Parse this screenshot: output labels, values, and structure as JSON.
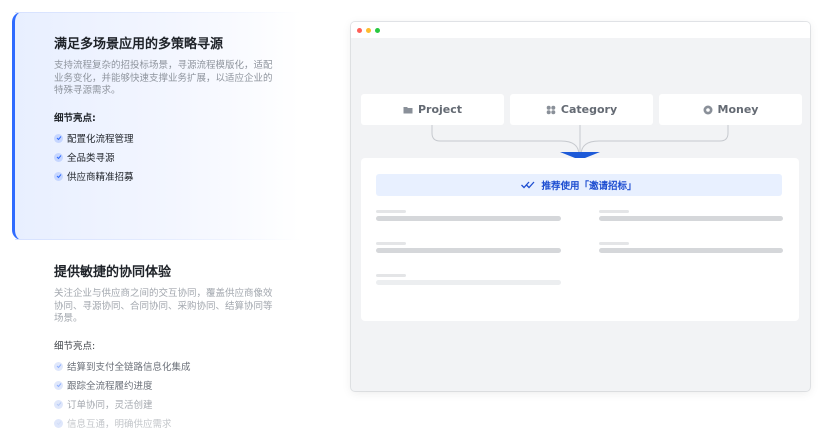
{
  "features": [
    {
      "title": "满足多场景应用的多策略寻源",
      "desc": "支持流程复杂的招投标场景，寻源流程模版化，适配业务变化，并能够快速支撑业务扩展，以适应企业的特殊寻源需求。",
      "sub_label": "细节亮点:",
      "items": [
        "配置化流程管理",
        "全品类寻源",
        "供应商精准招募"
      ]
    },
    {
      "title": "提供敏捷的协同体验",
      "desc": "关注企业与供应商之间的交互协同，覆盖供应商像效协同、寻源协同、合同协同、采购协同、结算协同等场景。",
      "sub_label": "细节亮点:",
      "items": [
        "结算到支付全链路信息化集成",
        "跟踪全流程履约进度",
        "订单协同，灵活创建",
        "信息互通，明确供应需求"
      ]
    }
  ],
  "window": {
    "chips": [
      {
        "icon": "folder-icon",
        "label": "Project"
      },
      {
        "icon": "grid-icon",
        "label": "Category"
      },
      {
        "icon": "coin-icon",
        "label": "Money"
      }
    ],
    "recommend_label": "推荐使用「邀请招标」"
  },
  "colors": {
    "accent": "#2f6bff",
    "recommend_bg": "#e8f0ff",
    "recommend_text": "#1f4fd1"
  }
}
